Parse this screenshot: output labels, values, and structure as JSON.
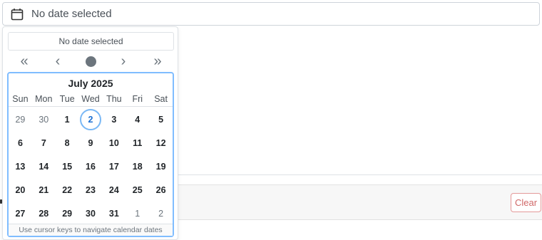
{
  "input": {
    "value": "No date selected",
    "icon": "calendar-icon"
  },
  "popup": {
    "selected_value": "No date selected",
    "nav": {
      "prev_year": "«",
      "prev_month": "‹",
      "next_month": "›",
      "next_year": "»"
    },
    "calendar": {
      "month_title": "July 2025",
      "weekdays": [
        "Sun",
        "Mon",
        "Tue",
        "Wed",
        "Thu",
        "Fri",
        "Sat"
      ],
      "weeks": [
        [
          {
            "d": "29",
            "o": true
          },
          {
            "d": "30",
            "o": true
          },
          {
            "d": "1"
          },
          {
            "d": "2",
            "today": true
          },
          {
            "d": "3"
          },
          {
            "d": "4"
          },
          {
            "d": "5"
          }
        ],
        [
          {
            "d": "6"
          },
          {
            "d": "7"
          },
          {
            "d": "8"
          },
          {
            "d": "9"
          },
          {
            "d": "10"
          },
          {
            "d": "11"
          },
          {
            "d": "12"
          }
        ],
        [
          {
            "d": "13"
          },
          {
            "d": "14"
          },
          {
            "d": "15"
          },
          {
            "d": "16"
          },
          {
            "d": "17"
          },
          {
            "d": "18"
          },
          {
            "d": "19"
          }
        ],
        [
          {
            "d": "20"
          },
          {
            "d": "21"
          },
          {
            "d": "22"
          },
          {
            "d": "23"
          },
          {
            "d": "24"
          },
          {
            "d": "25"
          },
          {
            "d": "26"
          }
        ],
        [
          {
            "d": "27"
          },
          {
            "d": "28"
          },
          {
            "d": "29"
          },
          {
            "d": "30"
          },
          {
            "d": "31"
          },
          {
            "d": "1",
            "o": true
          },
          {
            "d": "2",
            "o": true
          }
        ]
      ],
      "help_text": "Use cursor keys to navigate calendar dates"
    }
  },
  "clear_button": {
    "label": "Clear"
  },
  "colors": {
    "accent": "#80bdff",
    "today_ring": "#7ab8f5",
    "danger": "#d06868"
  }
}
